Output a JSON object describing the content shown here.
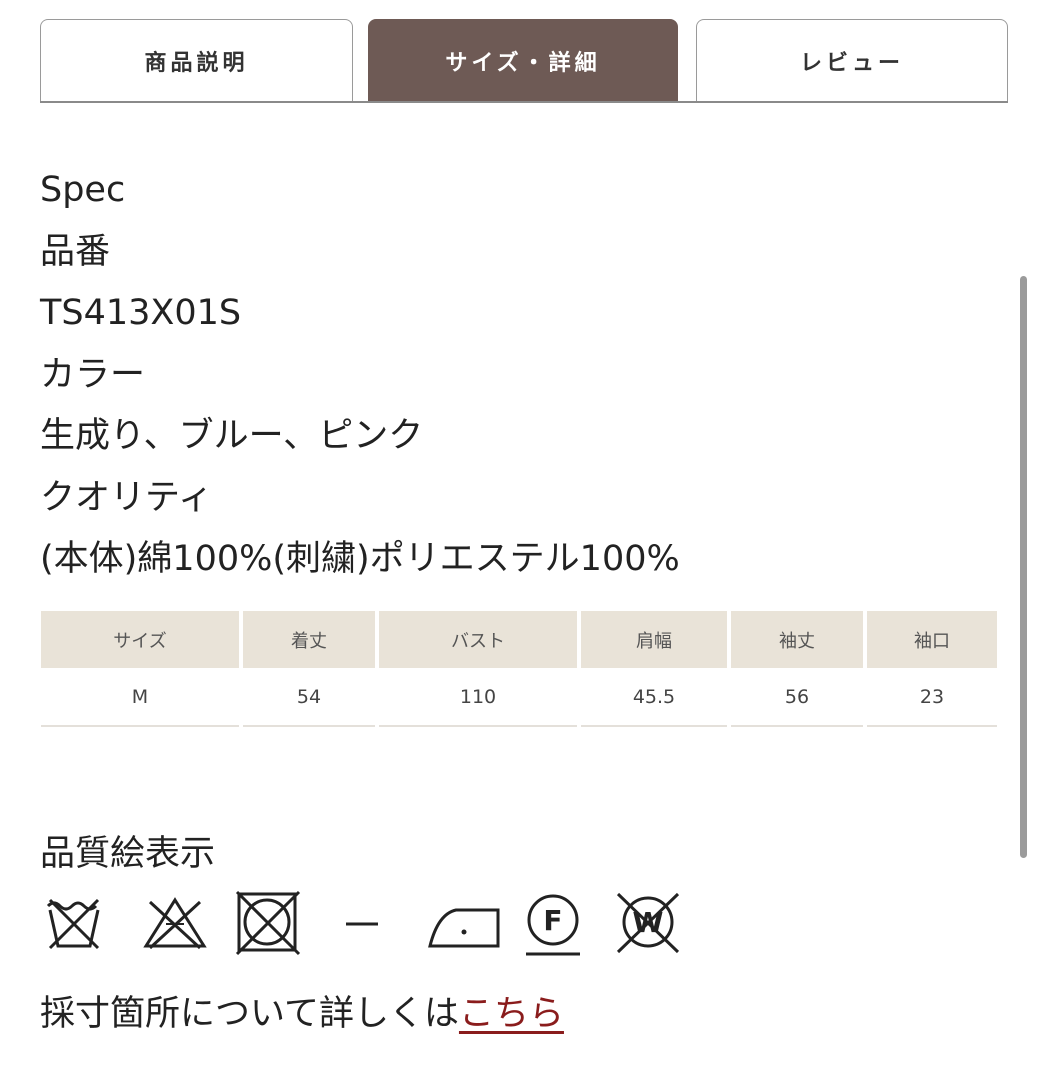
{
  "tabs": [
    {
      "label": "商品説明",
      "active": false
    },
    {
      "label": "サイズ・詳細",
      "active": true
    },
    {
      "label": "レビュー",
      "active": false
    }
  ],
  "spec": {
    "heading": "Spec",
    "product_number_label": "品番",
    "product_number": "TS413X01S",
    "color_label": "カラー",
    "colors": "生成り、ブルー、ピンク",
    "quality_label": "クオリティ",
    "quality": "(本体)綿100%(刺繍)ポリエステル100%"
  },
  "size_table": {
    "headers": [
      "サイズ",
      "着丈",
      "バスト",
      "肩幅",
      "袖丈",
      "袖口"
    ],
    "rows": [
      [
        "M",
        "54",
        "110",
        "45.5",
        "56",
        "23"
      ]
    ]
  },
  "care": {
    "label": "品質絵表示",
    "icons": [
      "no-wash-icon",
      "no-bleach-icon",
      "no-tumble-dry-icon",
      "dash-icon",
      "iron-low-icon",
      "dry-clean-f-icon",
      "no-wet-clean-icon"
    ]
  },
  "measure": {
    "text": "採寸箇所について詳しくは",
    "link": "こちら"
  },
  "colors": {
    "active_tab": "#6e5a55",
    "table_header": "#e9e3d8",
    "link": "#8a1c1c"
  }
}
